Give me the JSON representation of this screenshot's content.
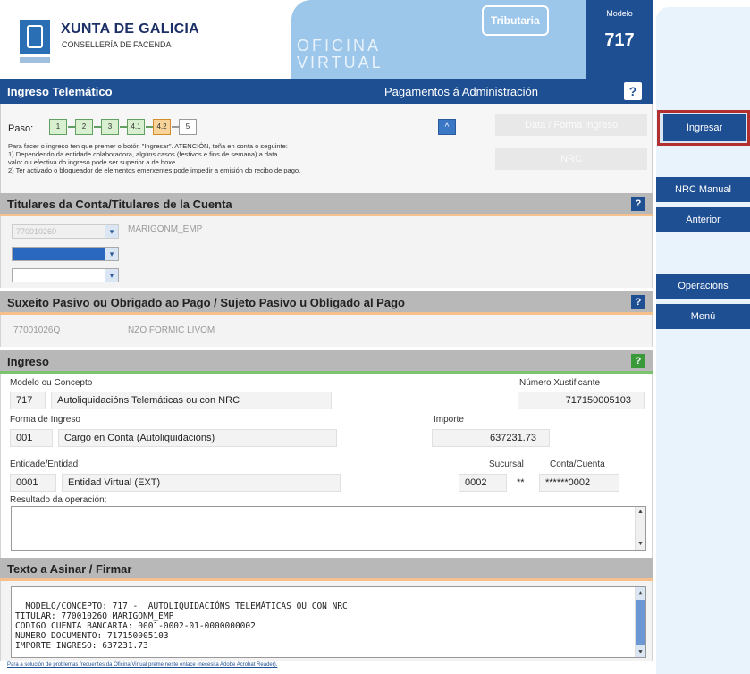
{
  "header": {
    "org_name": "XUNTA DE GALICIA",
    "org_sub": "CONSELLERÍA DE FACENDA",
    "office_line1": "OFICINA",
    "office_line2": "VIRTUAL",
    "badge": "Tributaria",
    "modelo_label": "Modelo",
    "modelo_number": "717"
  },
  "titlebar": {
    "left": "Ingreso Telemático",
    "right": "Pagamentos á Administración",
    "help": "?"
  },
  "steps": {
    "label": "Paso:",
    "items": [
      "1",
      "2",
      "3",
      "4.1",
      "4.2",
      "5"
    ],
    "collapse": "^",
    "info": "Para facer o ingreso ten que premer o botón \"Ingresar\". ATENCIÓN, teña en conta o seguinte:\n1) Dependendo da entidade colaboradora, algúns casos (festivos e fins de semana) a data\nvalor ou efectiva do ingreso pode ser superior a de hoxe.\n2) Ter activado o bloqueador de elementos emerxentes pode impedir a emisión do recibo de pago.",
    "ghost1": "Data / Forma Ingreso",
    "ghost2": "NRC"
  },
  "titulares": {
    "title": "Titulares da Conta/Titulares de la Cuenta",
    "row1_id": "770010260",
    "row1_name": "MARIGONM_EMP",
    "help": "?"
  },
  "suxeito": {
    "title": "Suxeito Pasivo ou Obrigado ao Pago / Sujeto Pasivo u Obligado al Pago",
    "id": "77001026Q",
    "name": "NZO FORMIC LIVOM",
    "help": "?"
  },
  "ingreso": {
    "title": "Ingreso",
    "help": "?",
    "modelo_label": "Modelo ou Concepto",
    "modelo_code": "717",
    "modelo_desc": "Autoliquidacións Telemáticas ou con NRC",
    "num_label": "Número Xustificante",
    "num_value": "717150005103",
    "forma_label": "Forma de Ingreso",
    "forma_code": "001",
    "forma_desc": "Cargo en Conta (Autoliquidacións)",
    "importe_label": "Importe",
    "importe_value": "637231.73",
    "entidade_label": "Entidade/Entidad",
    "entidade_code": "0001",
    "entidade_desc": "Entidad Virtual (EXT)",
    "sucursal_label": "Sucursal",
    "sucursal_value": "0002",
    "dc_value": "**",
    "conta_label": "Conta/Cuenta",
    "conta_value": "******0002",
    "resultado_label": "Resultado da operación:"
  },
  "firmar": {
    "title": "Texto a Asinar / Firmar",
    "text": "MODELO/CONCEPTO: 717 -  AUTOLIQUIDACIÓNS TELEMÁTICAS OU CON NRC\nTITULAR: 77001026Q MARIGONM_EMP\nCODIGO CUENTA BANCARIA: 0001-0002-01-0000000002\nNUMERO DOCUMENTO: 717150005103\nIMPORTE INGRESO: 637231.73"
  },
  "footer": "Para a solución de problemas frecuentes da Oficina Virtual preme neste enlace (necesita Adobe Acrobat Reader).",
  "rail": {
    "ingresar": "Ingresar",
    "nrc_manual": "NRC Manual",
    "anterior": "Anterior",
    "operacions": "Operacións",
    "menu": "Menú"
  }
}
